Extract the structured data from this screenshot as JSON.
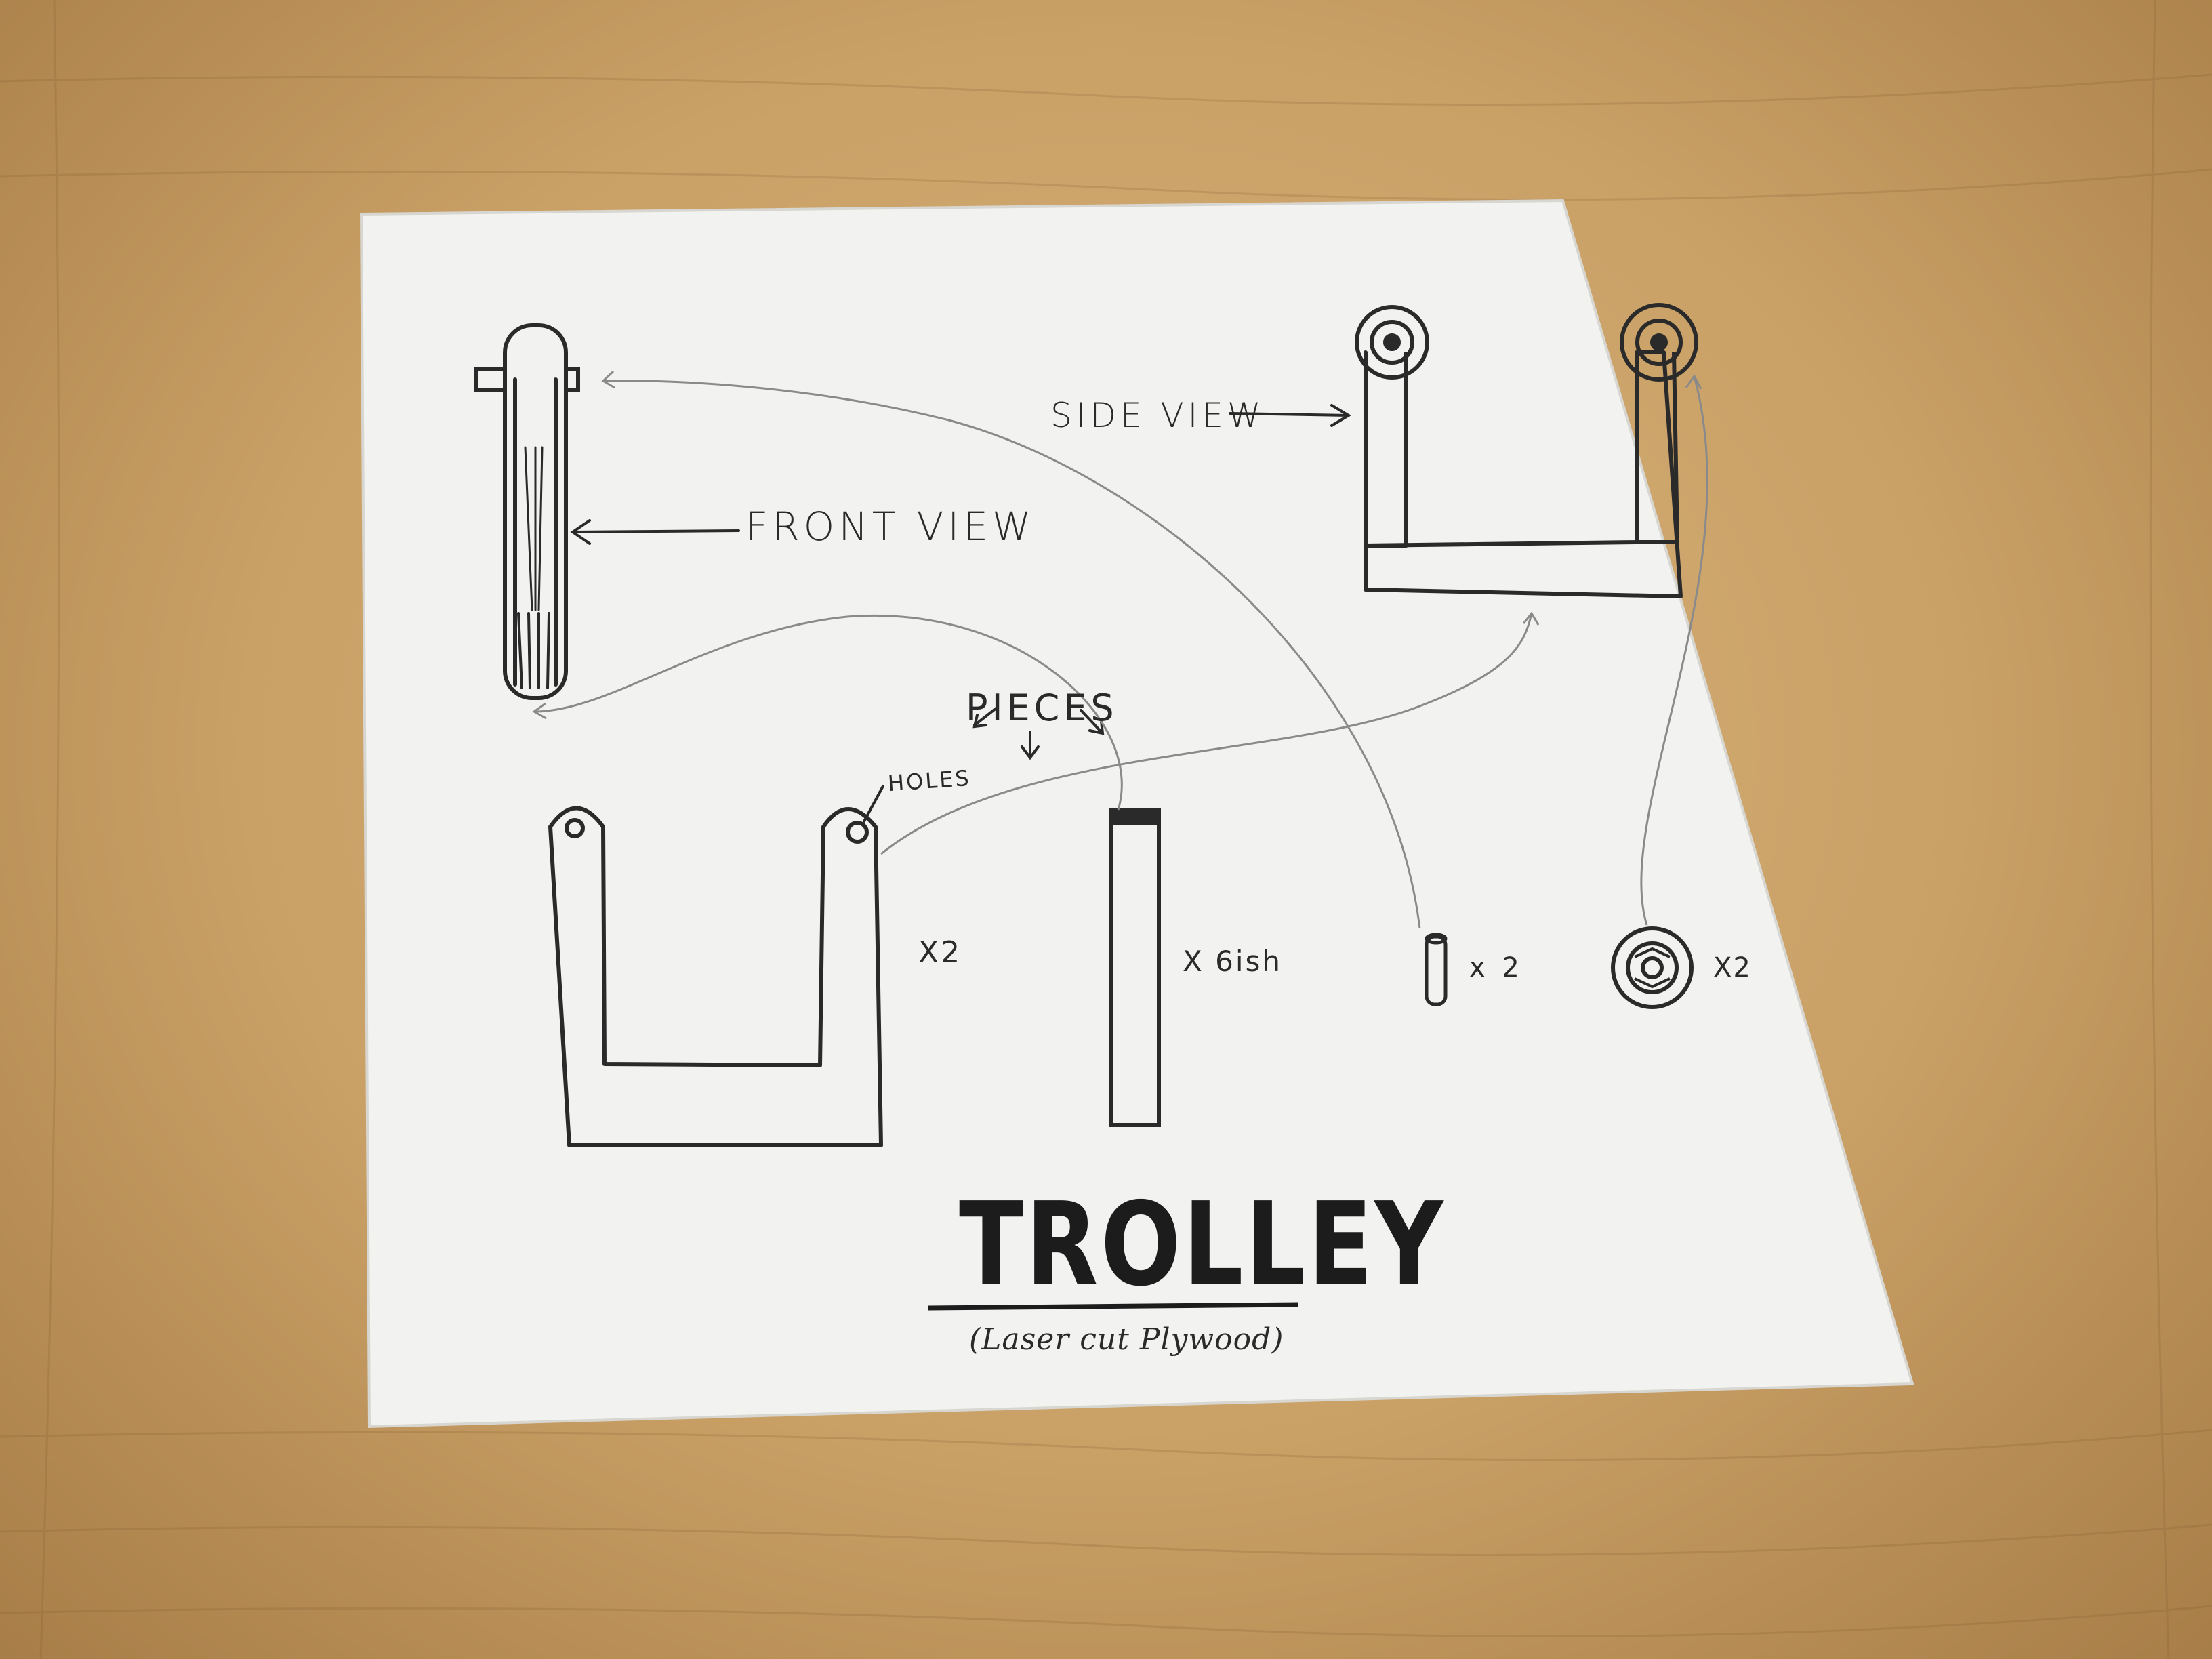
{
  "labels": {
    "front_view": "FRONT VIEW",
    "side_view": "SIDE VIEW",
    "pieces": "PIECES",
    "holes": "HOLES",
    "qty_frame": "X2",
    "qty_slats": "X 6ish",
    "qty_pins": "x 2",
    "qty_wheels": "X2",
    "title": "TROLLEY",
    "subtitle": "(Laser cut Plywood)"
  },
  "colors": {
    "desk": "#c9a066",
    "paper": "#f2f2f0",
    "ink": "#2a2a2a",
    "pencil": "#8a8a8a"
  }
}
